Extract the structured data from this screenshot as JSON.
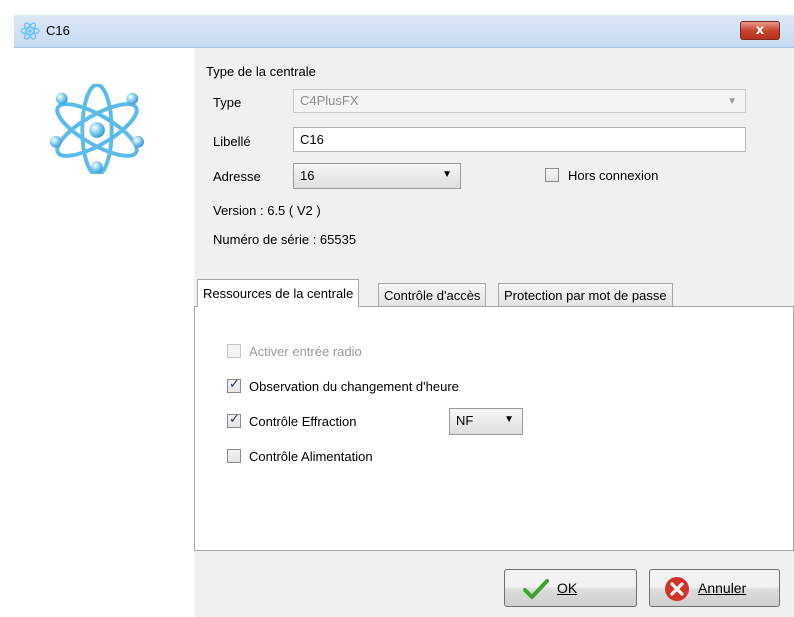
{
  "window": {
    "title": "C16",
    "close_label": "x"
  },
  "central": {
    "group_label": "Type de la centrale",
    "type_label": "Type",
    "type_value": "C4PlusFX",
    "libelle_label": "Libellé",
    "libelle_value": "C16",
    "adresse_label": "Adresse",
    "adresse_value": "16",
    "offline_label": "Hors connexion",
    "offline_checked": false,
    "version_text": "Version : 6.5 ( V2 )",
    "serial_text": "Numéro de série : 65535"
  },
  "tabs": [
    {
      "label": "Ressources de la centrale",
      "active": true
    },
    {
      "label": "Contrôle d'accès",
      "active": false
    },
    {
      "label": "Protection par mot de passe",
      "active": false
    }
  ],
  "resources": {
    "radio_label": "Activer entrée radio",
    "radio_checked": false,
    "radio_enabled": false,
    "dst_label": "Observation du changement d'heure",
    "dst_checked": true,
    "effraction_label": "Contrôle Effraction",
    "effraction_checked": true,
    "effraction_mode": "NF",
    "alimentation_label": "Contrôle Alimentation",
    "alimentation_checked": false
  },
  "buttons": {
    "ok_label": "OK",
    "cancel_label": "Annuler"
  },
  "icons": {
    "title": "atom-icon",
    "logo": "atom-logo-icon",
    "ok": "checkmark-icon",
    "cancel": "cancel-x-icon"
  },
  "colors": {
    "accent": "#4fb3e8",
    "close_button": "#c6442e",
    "ok_check": "#3aa52a",
    "cancel_red": "#d1322a"
  }
}
